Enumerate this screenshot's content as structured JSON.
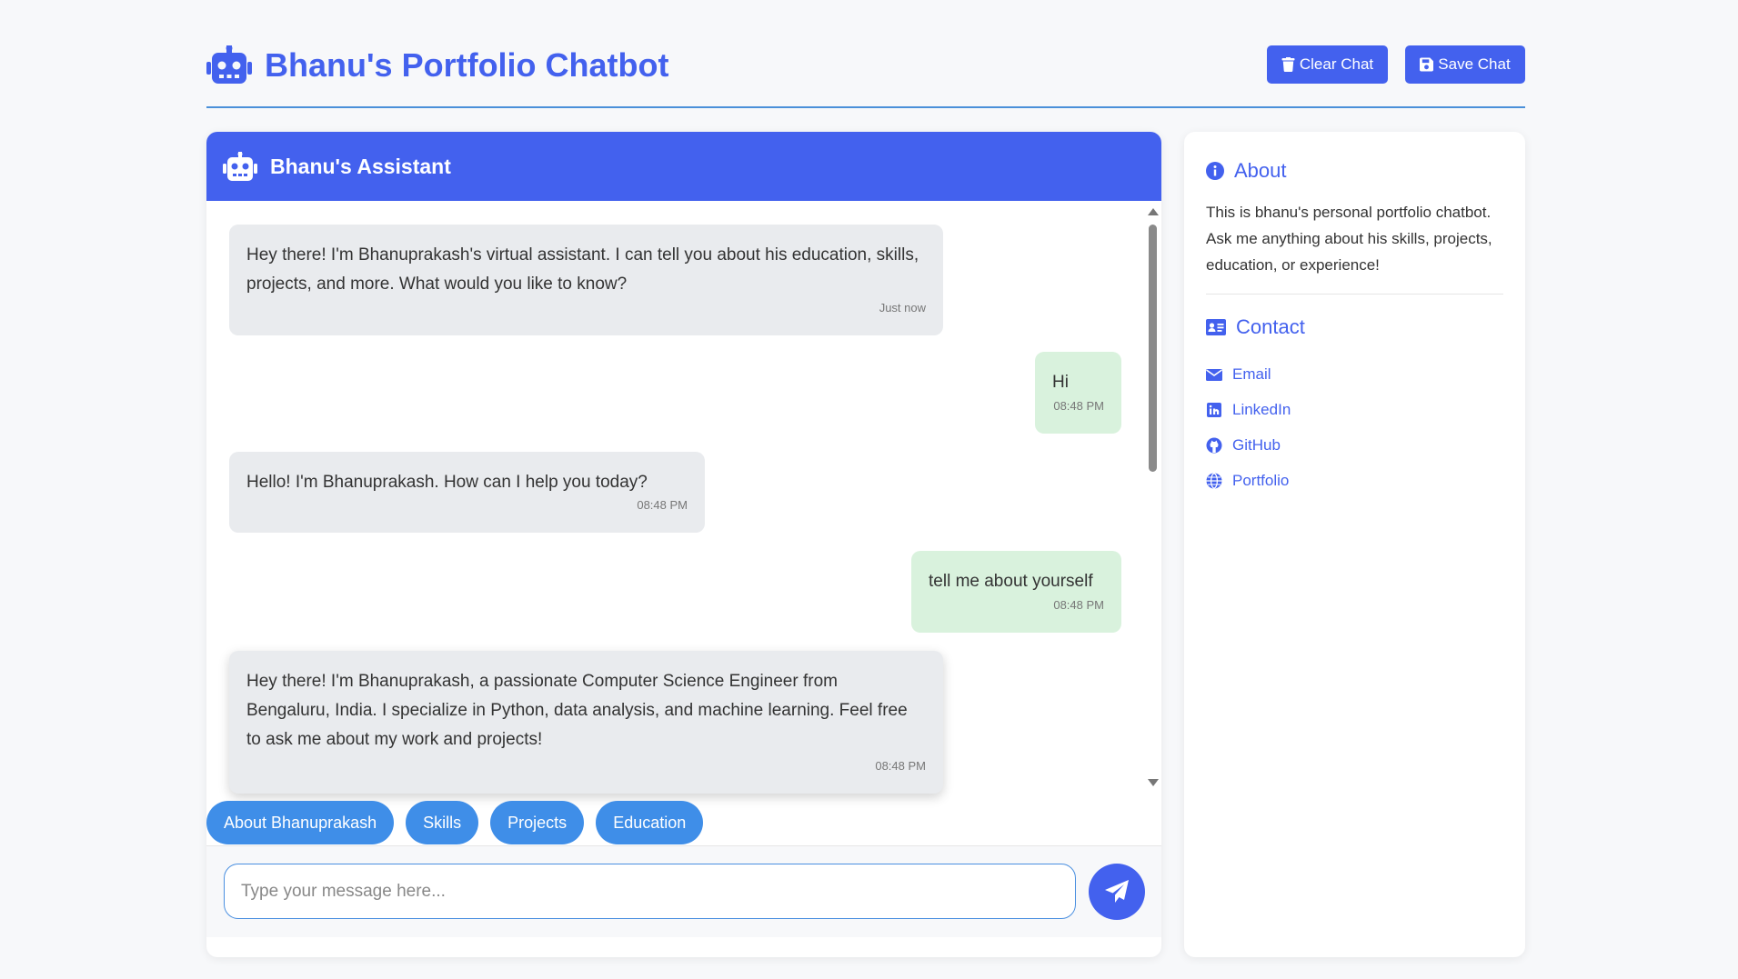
{
  "header": {
    "title": "Bhanu's Portfolio Chatbot",
    "clear_label": "Clear Chat",
    "save_label": "Save Chat"
  },
  "chat": {
    "assistant_name": "Bhanu's Assistant",
    "messages": [
      {
        "role": "bot",
        "text": "Hey there! I'm Bhanuprakash's virtual assistant. I can tell you about his education, skills, projects, and more. What would you like to know?",
        "time": "Just now"
      },
      {
        "role": "user",
        "text": "Hi",
        "time": "08:48 PM"
      },
      {
        "role": "bot",
        "text": "Hello! I'm Bhanuprakash. How can I help you today?",
        "time": "08:48 PM"
      },
      {
        "role": "user",
        "text": "tell me about yourself",
        "time": "08:48 PM"
      },
      {
        "role": "bot",
        "text": "Hey there! I'm Bhanuprakash, a passionate Computer Science Engineer from Bengaluru, India. I specialize in Python, data analysis, and machine learning. Feel free to ask me about my work and projects!",
        "time": "08:48 PM"
      }
    ],
    "quick_replies": [
      "About Bhanuprakash",
      "Skills",
      "Projects",
      "Education"
    ],
    "input": {
      "value": "",
      "placeholder": "Type your message here..."
    }
  },
  "sidebar": {
    "about_title": "About",
    "about_text": "This is bhanu's personal portfolio chatbot. Ask me anything about his skills, projects, education, or experience!",
    "contact_title": "Contact",
    "contacts": [
      {
        "label": "Email",
        "icon": "envelope-icon"
      },
      {
        "label": "LinkedIn",
        "icon": "linkedin-icon"
      },
      {
        "label": "GitHub",
        "icon": "github-icon"
      },
      {
        "label": "Portfolio",
        "icon": "globe-icon"
      }
    ]
  },
  "colors": {
    "primary": "#4361ee",
    "chip": "#3f8ee8",
    "bot_bubble": "#e9ebee",
    "user_bubble": "#d9f2dd",
    "background": "#f7f8fa"
  }
}
